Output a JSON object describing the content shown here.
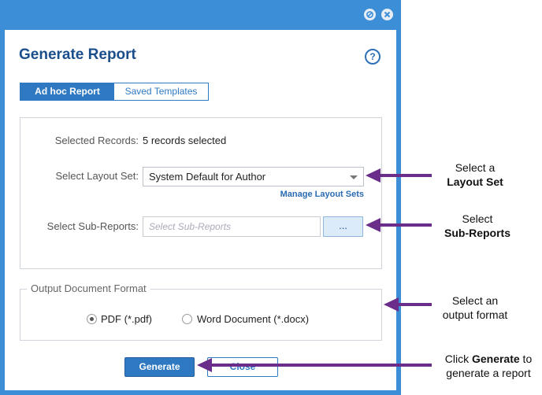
{
  "dialog": {
    "title": "Generate Report",
    "help_symbol": "?",
    "tabs": [
      {
        "label": "Ad hoc Report",
        "active": true
      },
      {
        "label": "Saved Templates",
        "active": false
      }
    ],
    "selected_records": {
      "label": "Selected Records:",
      "value": "5 records selected"
    },
    "layout_set": {
      "label": "Select Layout Set:",
      "value": "System Default for Author",
      "manage_link": "Manage Layout Sets"
    },
    "sub_reports": {
      "label": "Select Sub-Reports:",
      "placeholder": "Select Sub-Reports",
      "browse_label": "..."
    },
    "output_format": {
      "legend": "Output Document Format",
      "options": [
        {
          "label": "PDF (*.pdf)",
          "selected": true
        },
        {
          "label": "Word Document (*.docx)",
          "selected": false
        }
      ]
    },
    "buttons": {
      "generate": "Generate",
      "close": "Close"
    }
  },
  "annotations": {
    "layout": {
      "line1": "Select a",
      "line2": "Layout Set"
    },
    "subreports": {
      "line1": "Select",
      "line2": "Sub-Reports"
    },
    "output": {
      "line1": "Select an",
      "line2": "output format"
    },
    "generate": {
      "prefix": "Click ",
      "bold": "Generate",
      "suffix": " to",
      "line2": "generate a report"
    }
  },
  "colors": {
    "accent": "#2e79c2",
    "frame": "#3c8fd7",
    "arrow": "#6a2d8a"
  }
}
